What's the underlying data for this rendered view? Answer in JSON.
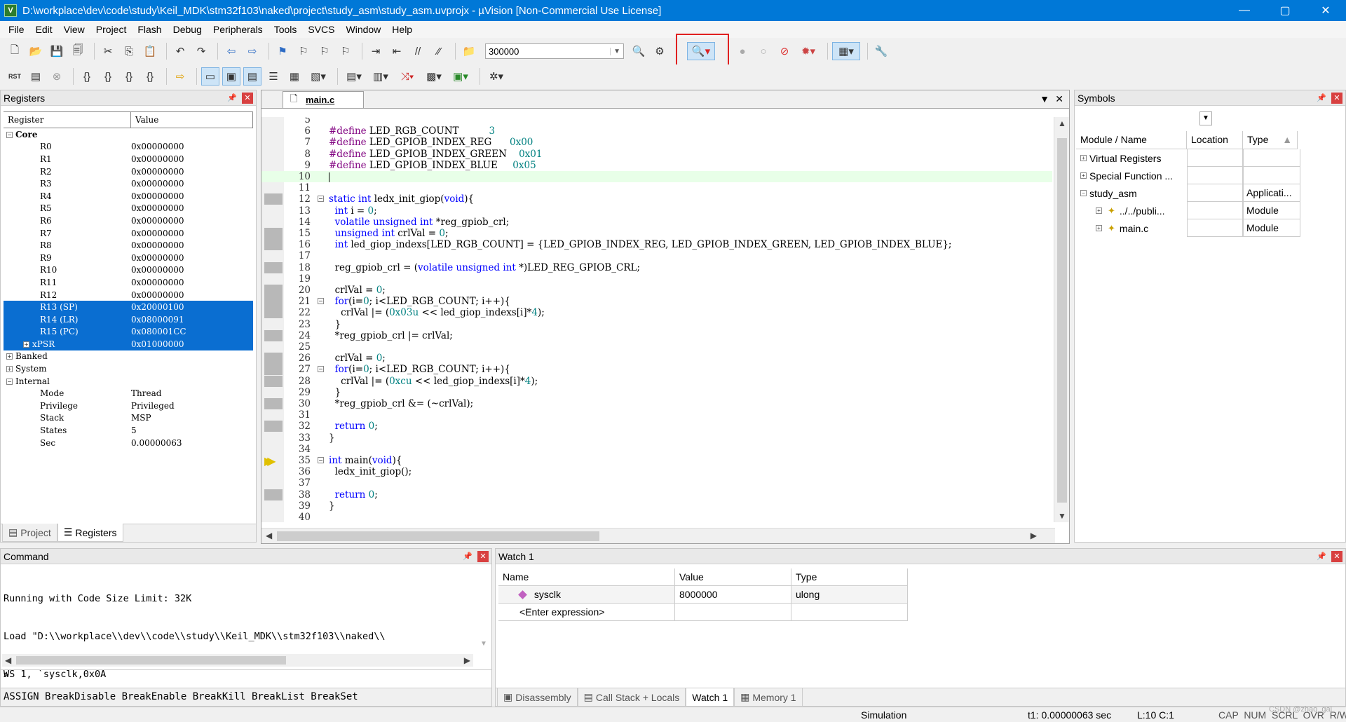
{
  "window": {
    "title": "D:\\workplace\\dev\\code\\study\\Keil_MDK\\stm32f103\\naked\\project\\study_asm\\study_asm.uvprojx - µVision  [Non-Commercial Use License]",
    "app_icon": "keil-uv-icon",
    "minimize": "—",
    "maximize": "▢",
    "close": "✕"
  },
  "menu": [
    "File",
    "Edit",
    "View",
    "Project",
    "Flash",
    "Debug",
    "Peripherals",
    "Tools",
    "SVCS",
    "Window",
    "Help"
  ],
  "toolbar1": {
    "combo_value": "300000"
  },
  "toolbar2": {
    "reset_label": "RST"
  },
  "registers": {
    "title": "Registers",
    "col_register": "Register",
    "col_value": "Value",
    "rows": [
      {
        "name": "Core",
        "value": "",
        "level": 0,
        "toggle": "−",
        "bold": true
      },
      {
        "name": "R0",
        "value": "0x00000000",
        "level": 2
      },
      {
        "name": "R1",
        "value": "0x00000000",
        "level": 2
      },
      {
        "name": "R2",
        "value": "0x00000000",
        "level": 2
      },
      {
        "name": "R3",
        "value": "0x00000000",
        "level": 2
      },
      {
        "name": "R4",
        "value": "0x00000000",
        "level": 2
      },
      {
        "name": "R5",
        "value": "0x00000000",
        "level": 2
      },
      {
        "name": "R6",
        "value": "0x00000000",
        "level": 2
      },
      {
        "name": "R7",
        "value": "0x00000000",
        "level": 2
      },
      {
        "name": "R8",
        "value": "0x00000000",
        "level": 2
      },
      {
        "name": "R9",
        "value": "0x00000000",
        "level": 2
      },
      {
        "name": "R10",
        "value": "0x00000000",
        "level": 2
      },
      {
        "name": "R11",
        "value": "0x00000000",
        "level": 2
      },
      {
        "name": "R12",
        "value": "0x00000000",
        "level": 2
      },
      {
        "name": "R13 (SP)",
        "value": "0x20000100",
        "level": 2,
        "selected": true
      },
      {
        "name": "R14 (LR)",
        "value": "0x08000091",
        "level": 2,
        "selected": true
      },
      {
        "name": "R15 (PC)",
        "value": "0x080001CC",
        "level": 2,
        "selected": true
      },
      {
        "name": "xPSR",
        "value": "0x01000000",
        "level": 1,
        "toggle": "+",
        "selected": true
      },
      {
        "name": "Banked",
        "value": "",
        "level": 0,
        "toggle": "+"
      },
      {
        "name": "System",
        "value": "",
        "level": 0,
        "toggle": "+"
      },
      {
        "name": "Internal",
        "value": "",
        "level": 0,
        "toggle": "−"
      },
      {
        "name": "Mode",
        "value": "Thread",
        "level": 2
      },
      {
        "name": "Privilege",
        "value": "Privileged",
        "level": 2
      },
      {
        "name": "Stack",
        "value": "MSP",
        "level": 2
      },
      {
        "name": "States",
        "value": "5",
        "level": 2
      },
      {
        "name": "Sec",
        "value": "0.00000063",
        "level": 2
      }
    ],
    "tab_project": "Project",
    "tab_registers": "Registers"
  },
  "editor": {
    "tab": "main.c",
    "lines": [
      {
        "n": "5",
        "code": ""
      },
      {
        "n": "6",
        "code": "#define LED_RGB_COUNT          3"
      },
      {
        "n": "7",
        "code": "#define LED_GPIOB_INDEX_REG      0x00"
      },
      {
        "n": "8",
        "code": "#define LED_GPIOB_INDEX_GREEN    0x01"
      },
      {
        "n": "9",
        "code": "#define LED_GPIOB_INDEX_BLUE     0x05"
      },
      {
        "n": "10",
        "code": "",
        "current": true
      },
      {
        "n": "11",
        "code": ""
      },
      {
        "n": "12",
        "code": "static int ledx_init_giop(void){",
        "fold": "−",
        "mark": true
      },
      {
        "n": "13",
        "code": "  int i = 0;"
      },
      {
        "n": "14",
        "code": "  volatile unsigned int *reg_gpiob_crl;"
      },
      {
        "n": "15",
        "code": "  unsigned int crlVal = 0;",
        "mark": true
      },
      {
        "n": "16",
        "code": "  int led_giop_indexs[LED_RGB_COUNT] = {LED_GPIOB_INDEX_REG, LED_GPIOB_INDEX_GREEN, LED_GPIOB_INDEX_BLUE};",
        "mark": true
      },
      {
        "n": "17",
        "code": ""
      },
      {
        "n": "18",
        "code": "  reg_gpiob_crl = (volatile unsigned int *)LED_REG_GPIOB_CRL;",
        "mark": true
      },
      {
        "n": "19",
        "code": ""
      },
      {
        "n": "20",
        "code": "  crlVal = 0;",
        "mark": true
      },
      {
        "n": "21",
        "code": "  for(i=0; i<LED_RGB_COUNT; i++){",
        "fold": "−",
        "mark": true
      },
      {
        "n": "22",
        "code": "    crlVal |= (0x03u << led_giop_indexs[i]*4);",
        "mark": true
      },
      {
        "n": "23",
        "code": "  }"
      },
      {
        "n": "24",
        "code": "  *reg_gpiob_crl |= crlVal;",
        "mark": true
      },
      {
        "n": "25",
        "code": ""
      },
      {
        "n": "26",
        "code": "  crlVal = 0;",
        "mark": true
      },
      {
        "n": "27",
        "code": "  for(i=0; i<LED_RGB_COUNT; i++){",
        "fold": "−",
        "mark": true
      },
      {
        "n": "28",
        "code": "    crlVal |= (0xcu << led_giop_indexs[i]*4);",
        "mark": true
      },
      {
        "n": "29",
        "code": "  }"
      },
      {
        "n": "30",
        "code": "  *reg_gpiob_crl &= (~crlVal);",
        "mark": true
      },
      {
        "n": "31",
        "code": ""
      },
      {
        "n": "32",
        "code": "  return 0;",
        "mark": true
      },
      {
        "n": "33",
        "code": "}"
      },
      {
        "n": "34",
        "code": ""
      },
      {
        "n": "35",
        "code": "int main(void){",
        "fold": "−",
        "arrow": true
      },
      {
        "n": "36",
        "code": "  ledx_init_giop();"
      },
      {
        "n": "37",
        "code": ""
      },
      {
        "n": "38",
        "code": "  return 0;",
        "mark": true
      },
      {
        "n": "39",
        "code": "}"
      },
      {
        "n": "40",
        "code": ""
      }
    ]
  },
  "symbols": {
    "title": "Symbols",
    "col_name": "Module / Name",
    "col_location": "Location",
    "col_type": "Type",
    "rows": [
      {
        "name": "Virtual Registers",
        "type": "",
        "toggle": "+"
      },
      {
        "name": "Special Function ...",
        "type": "",
        "toggle": "+"
      },
      {
        "name": "study_asm",
        "type": "Applicati...",
        "toggle": "−"
      },
      {
        "name": "../../publi...",
        "type": "Module",
        "toggle": "+",
        "indent": true
      },
      {
        "name": "main.c",
        "type": "Module",
        "toggle": "+",
        "indent": true
      }
    ]
  },
  "command": {
    "title": "Command",
    "output": [
      "Running with Code Size Limit: 32K",
      "Load \"D:\\\\workplace\\\\dev\\\\code\\\\study\\\\Keil_MDK\\\\stm32f103\\\\naked\\\\",
      "WS 1, `sysclk,0x0A"
    ],
    "prompt": ">",
    "help": "ASSIGN BreakDisable BreakEnable BreakKill BreakList BreakSet"
  },
  "watch": {
    "title": "Watch 1",
    "col_name": "Name",
    "col_value": "Value",
    "col_type": "Type",
    "rows": [
      {
        "name": "sysclk",
        "value": "8000000",
        "type": "ulong"
      },
      {
        "name": "<Enter expression>",
        "value": "",
        "type": ""
      }
    ],
    "tabs": [
      "Disassembly",
      "Call Stack + Locals",
      "Watch 1",
      "Memory 1"
    ]
  },
  "status": {
    "mode": "Simulation",
    "time": "t1: 0.00000063 sec",
    "cursor": "L:10 C:1",
    "flags": "CAP  NUM  SCRL  OVR  R/W",
    "watermark": "CSDN @zhao_gaj"
  }
}
